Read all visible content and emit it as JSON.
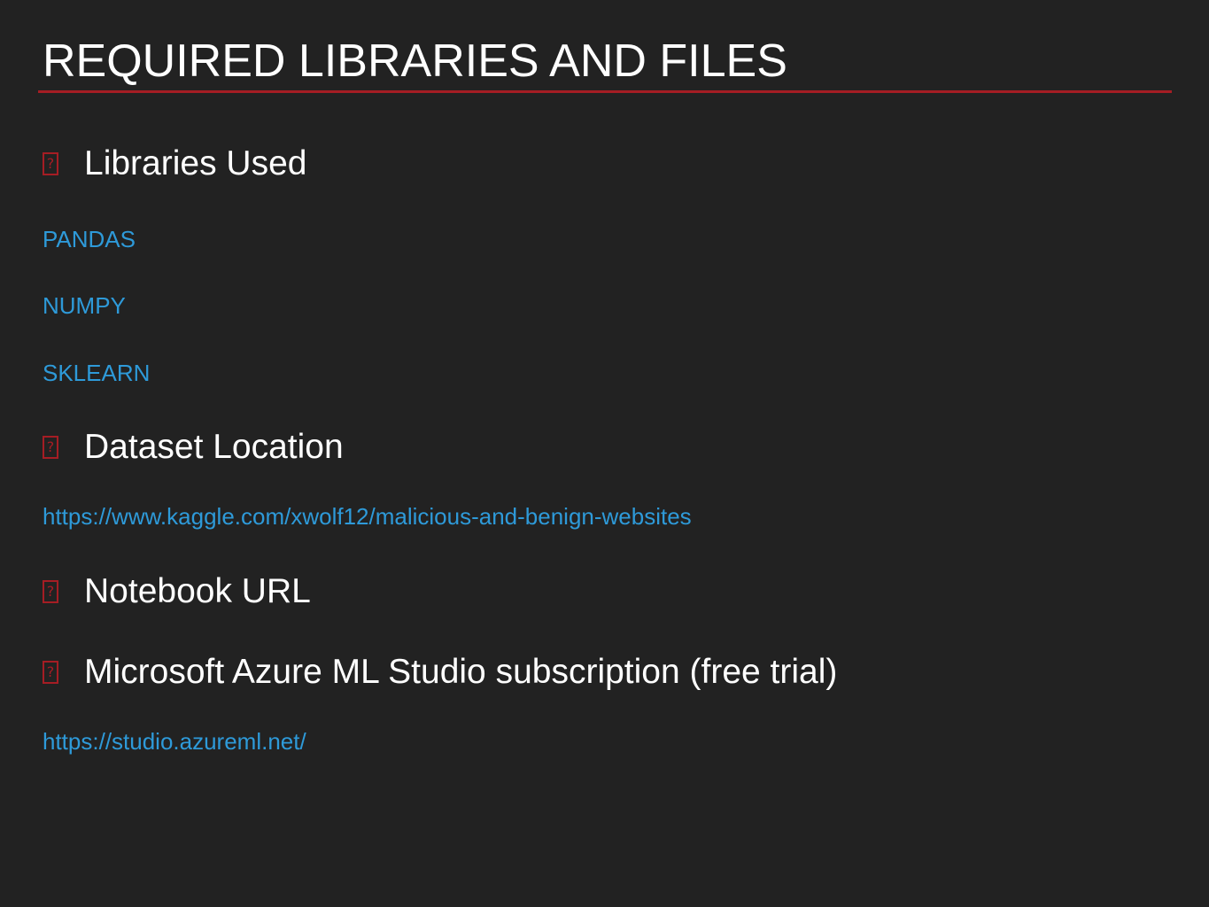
{
  "slide": {
    "title": "REQUIRED LIBRARIES AND FILES",
    "accent_color": "#a51d24",
    "link_color": "#2e9ad9",
    "background_color": "#222222"
  },
  "bullets": [
    {
      "icon": "missing-glyph-icon",
      "icon_glyph": "?",
      "label": "Libraries Used",
      "items": [
        "PANDAS",
        "NUMPY",
        "SKLEARN"
      ]
    },
    {
      "icon": "missing-glyph-icon",
      "icon_glyph": "?",
      "label": "Dataset Location",
      "items": [
        "https://www.kaggle.com/xwolf12/malicious-and-benign-websites"
      ]
    },
    {
      "icon": "missing-glyph-icon",
      "icon_glyph": "?",
      "label": "Notebook URL",
      "items": []
    },
    {
      "icon": "missing-glyph-icon",
      "icon_glyph": "?",
      "label": "Microsoft Azure ML Studio subscription (free trial)",
      "items": [
        "https://studio.azureml.net/"
      ]
    }
  ]
}
